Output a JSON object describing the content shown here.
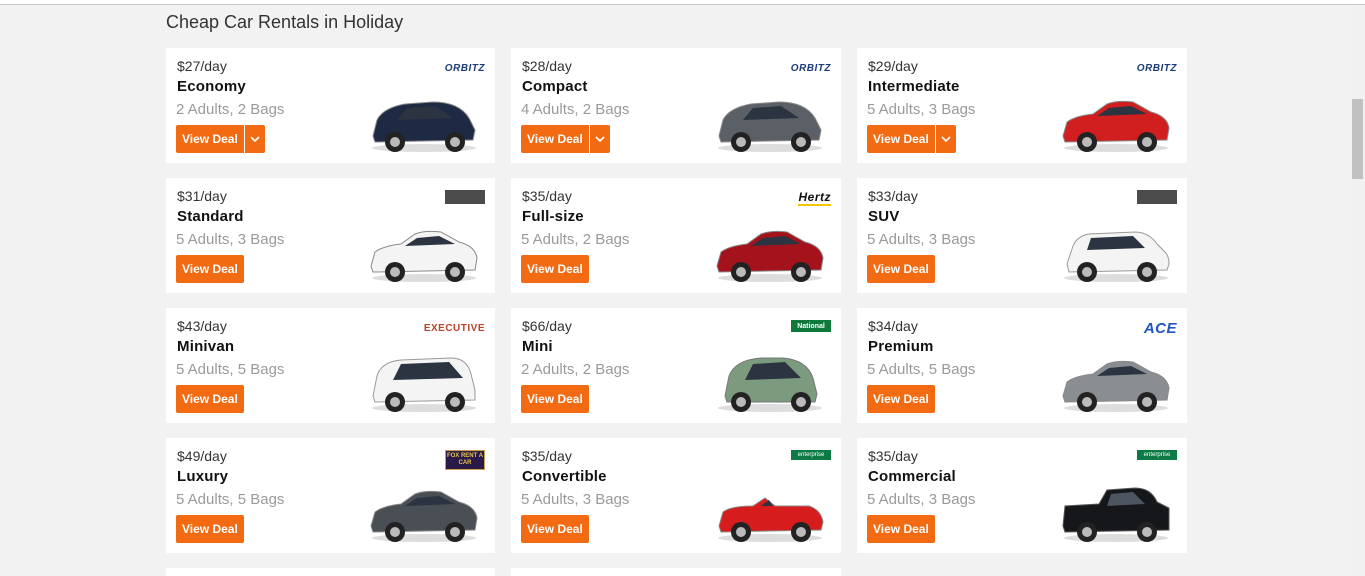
{
  "page": {
    "heading": "Cheap Car Rentals in Holiday"
  },
  "accent": "#f26a11",
  "deals": [
    {
      "price": "$27/day",
      "category": "Economy",
      "capacity": "2 Adults, 2 Bags",
      "button": "View Deal",
      "has_caret": true,
      "vendor": "ORBITZ",
      "vendor_style": "orbitz",
      "car_color": "#1e2a44",
      "car_type": "hatch"
    },
    {
      "price": "$28/day",
      "category": "Compact",
      "capacity": "4 Adults, 2 Bags",
      "button": "View Deal",
      "has_caret": true,
      "vendor": "ORBITZ",
      "vendor_style": "orbitz",
      "car_color": "#5b5f66",
      "car_type": "hatch"
    },
    {
      "price": "$29/day",
      "category": "Intermediate",
      "capacity": "5 Adults, 3 Bags",
      "button": "View Deal",
      "has_caret": true,
      "vendor": "ORBITZ",
      "vendor_style": "orbitz",
      "car_color": "#d11f1f",
      "car_type": "sedan"
    },
    {
      "price": "$31/day",
      "category": "Standard",
      "capacity": "5 Adults, 3 Bags",
      "button": "View Deal",
      "has_caret": false,
      "vendor": "",
      "vendor_style": "grey",
      "car_color": "#f4f4f4",
      "car_type": "sedan"
    },
    {
      "price": "$35/day",
      "category": "Full-size",
      "capacity": "5 Adults, 2 Bags",
      "button": "View Deal",
      "has_caret": false,
      "vendor": "Hertz",
      "vendor_style": "hertz",
      "car_color": "#a4131c",
      "car_type": "sedan"
    },
    {
      "price": "$33/day",
      "category": "SUV",
      "capacity": "5 Adults, 3 Bags",
      "button": "View Deal",
      "has_caret": false,
      "vendor": "",
      "vendor_style": "grey",
      "car_color": "#f4f4f4",
      "car_type": "suv"
    },
    {
      "price": "$43/day",
      "category": "Minivan",
      "capacity": "5 Adults, 5 Bags",
      "button": "View Deal",
      "has_caret": false,
      "vendor": "EXECUTIVE",
      "vendor_style": "exec",
      "car_color": "#f4f4f4",
      "car_type": "van"
    },
    {
      "price": "$66/day",
      "category": "Mini",
      "capacity": "2 Adults, 2 Bags",
      "button": "View Deal",
      "has_caret": false,
      "vendor": "National",
      "vendor_style": "national",
      "car_color": "#7c9a7e",
      "car_type": "mini"
    },
    {
      "price": "$34/day",
      "category": "Premium",
      "capacity": "5 Adults, 5 Bags",
      "button": "View Deal",
      "has_caret": false,
      "vendor": "ACE",
      "vendor_style": "ace",
      "car_color": "#8a8d92",
      "car_type": "sedan"
    },
    {
      "price": "$49/day",
      "category": "Luxury",
      "capacity": "5 Adults, 5 Bags",
      "button": "View Deal",
      "has_caret": false,
      "vendor": "FOX RENT A CAR",
      "vendor_style": "fox",
      "car_color": "#4a4e55",
      "car_type": "sedan"
    },
    {
      "price": "$35/day",
      "category": "Convertible",
      "capacity": "5 Adults, 3 Bags",
      "button": "View Deal",
      "has_caret": false,
      "vendor": "enterprise",
      "vendor_style": "ent",
      "car_color": "#d61c1c",
      "car_type": "conv"
    },
    {
      "price": "$35/day",
      "category": "Commercial",
      "capacity": "5 Adults, 3 Bags",
      "button": "View Deal",
      "has_caret": false,
      "vendor": "enterprise",
      "vendor_style": "ent",
      "car_color": "#15171a",
      "car_type": "truck"
    }
  ]
}
